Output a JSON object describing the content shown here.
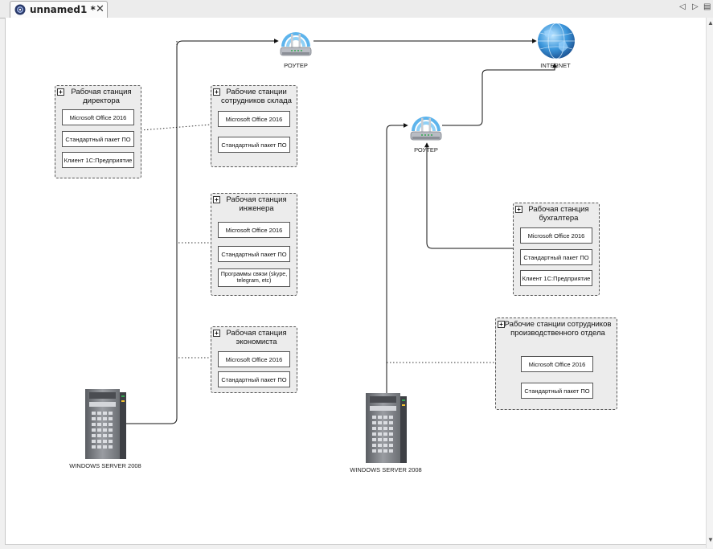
{
  "tab": {
    "title": "unnamed1 *",
    "close": "✕"
  },
  "nav": {
    "prev": "◁",
    "next": "▷",
    "menu": "▤"
  },
  "scroll": {
    "up": "▲",
    "down": "▼"
  },
  "nodes": {
    "router1": "РОУТЕР",
    "router2": "РОУТЕР",
    "internet": "INTERNET",
    "server1": "WINDOWS SERVER 2008",
    "server2": "WINDOWS SERVER 2008"
  },
  "groups": {
    "director": {
      "title": "Рабочая станция директора",
      "items": [
        "Microsoft Office 2016",
        "Стандартный пакет ПО",
        "Клиент 1С:Предприятие"
      ]
    },
    "warehouse": {
      "title": "Рабочие станции сотрудников склада",
      "items": [
        "Microsoft Office 2016",
        "Стандартный пакет ПО"
      ]
    },
    "engineer": {
      "title": "Рабочая станция инженера",
      "items": [
        "Microsoft Office 2016",
        "Стандартный пакет ПО",
        "Программы связи (skype, telegram, etc)"
      ]
    },
    "economist": {
      "title": "Рабочая станция экономиста",
      "items": [
        "Microsoft Office 2016",
        "Стандартный пакет ПО"
      ]
    },
    "accountant": {
      "title": "Рабочая станция бухгалтера",
      "items": [
        "Microsoft Office 2016",
        "Стандартный пакет ПО",
        "Клиент 1С:Предприятие"
      ]
    },
    "production": {
      "title": "Рабочие станции сотрудников производственного отдела",
      "items": [
        "Microsoft Office 2016",
        "Стандартный пакет ПО"
      ]
    }
  }
}
